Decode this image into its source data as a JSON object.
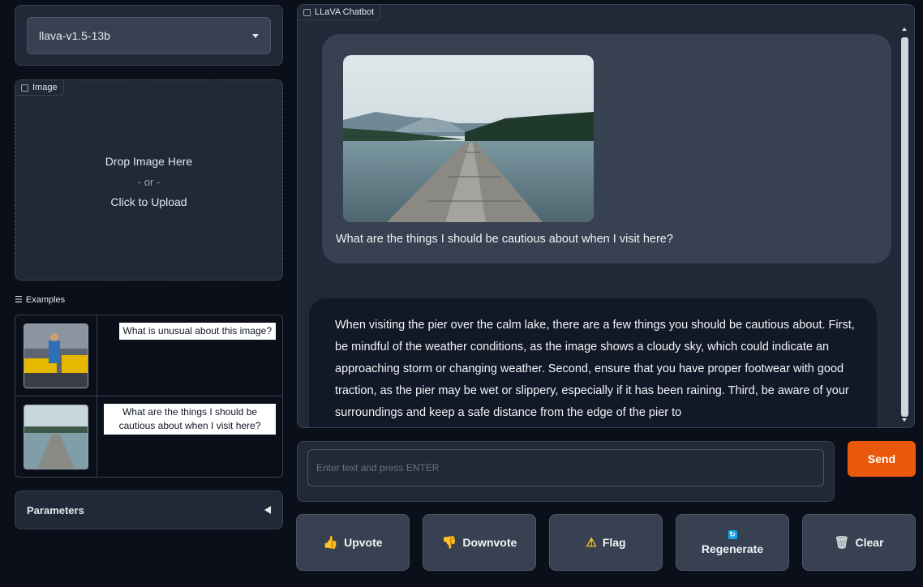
{
  "model_select": {
    "value": "llava-v1.5-13b"
  },
  "image_upload": {
    "label": "Image",
    "drop_text": "Drop Image Here",
    "or_text": "- or -",
    "click_text": "Click to Upload"
  },
  "examples": {
    "label": "Examples",
    "rows": [
      {
        "text": "What is unusual about this image?"
      },
      {
        "text": "What are the things I should be cautious about when I visit here?"
      }
    ]
  },
  "parameters": {
    "label": "Parameters"
  },
  "chatbot": {
    "label": "LLaVA Chatbot",
    "user_message": "What are the things I should be cautious about when I visit here?",
    "bot_message": "When visiting the pier over the calm lake, there are a few things you should be cautious about. First, be mindful of the weather conditions, as the image shows a cloudy sky, which could indicate an approaching storm or changing weather. Second, ensure that you have proper footwear with good traction, as the pier may be wet or slippery, especially if it has been raining. Third, be aware of your surroundings and keep a safe distance from the edge of the pier to"
  },
  "input": {
    "placeholder": "Enter text and press ENTER"
  },
  "send_label": "Send",
  "actions": {
    "upvote": "Upvote",
    "downvote": "Downvote",
    "flag": "Flag",
    "regenerate": "Regenerate",
    "clear": "Clear"
  },
  "colors": {
    "accent": "#ea580c",
    "background": "#0b0f19",
    "panel": "#1f2937"
  }
}
